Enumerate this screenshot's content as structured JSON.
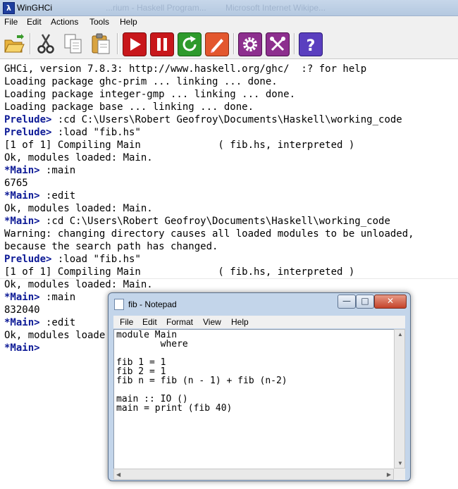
{
  "window": {
    "title": "WinGHCi",
    "bg_tabs": [
      "...rium - Haskell Program...",
      "Microsoft Internet  Wikipe..."
    ]
  },
  "menu": [
    "File",
    "Edit",
    "Actions",
    "Tools",
    "Help"
  ],
  "toolbar": [
    {
      "name": "open-icon",
      "label": "open"
    },
    {
      "name": "cut-icon",
      "label": "cut"
    },
    {
      "name": "copy-icon",
      "label": "copy"
    },
    {
      "name": "paste-icon",
      "label": "paste"
    },
    {
      "name": "run-icon",
      "label": "run"
    },
    {
      "name": "pause-icon",
      "label": "pause"
    },
    {
      "name": "reload-icon",
      "label": "reload"
    },
    {
      "name": "edit-icon",
      "label": "edit"
    },
    {
      "name": "options-icon",
      "label": "options"
    },
    {
      "name": "tools-icon",
      "label": "tools"
    },
    {
      "name": "help-icon",
      "label": "help"
    }
  ],
  "console": [
    {
      "prompt": "",
      "text": "GHCi, version 7.8.3: http://www.haskell.org/ghc/  :? for help"
    },
    {
      "prompt": "",
      "text": "Loading package ghc-prim ... linking ... done."
    },
    {
      "prompt": "",
      "text": "Loading package integer-gmp ... linking ... done."
    },
    {
      "prompt": "",
      "text": "Loading package base ... linking ... done."
    },
    {
      "prompt": "Prelude>",
      "text": " :cd C:\\Users\\Robert Geofroy\\Documents\\Haskell\\working_code"
    },
    {
      "prompt": "Prelude>",
      "text": " :load \"fib.hs\""
    },
    {
      "prompt": "",
      "text": "[1 of 1] Compiling Main             ( fib.hs, interpreted )"
    },
    {
      "prompt": "",
      "text": "Ok, modules loaded: Main."
    },
    {
      "prompt": "*Main>",
      "text": " :main"
    },
    {
      "prompt": "",
      "text": "6765"
    },
    {
      "prompt": "*Main>",
      "text": " :edit"
    },
    {
      "prompt": "",
      "text": "Ok, modules loaded: Main."
    },
    {
      "prompt": "*Main>",
      "text": " :cd C:\\Users\\Robert Geofroy\\Documents\\Haskell\\working_code"
    },
    {
      "prompt": "",
      "text": "Warning: changing directory causes all loaded modules to be unloaded,"
    },
    {
      "prompt": "",
      "text": "because the search path has changed."
    },
    {
      "prompt": "Prelude>",
      "text": " :load \"fib.hs\""
    },
    {
      "prompt": "",
      "text": "[1 of 1] Compiling Main             ( fib.hs, interpreted )"
    },
    {
      "prompt": "",
      "text": "Ok, modules loaded: Main."
    },
    {
      "prompt": "*Main>",
      "text": " :main"
    },
    {
      "prompt": "",
      "text": "832040"
    },
    {
      "prompt": "*Main>",
      "text": " :edit"
    },
    {
      "prompt": "",
      "text": "Ok, modules loade"
    },
    {
      "prompt": "*Main>",
      "text": ""
    }
  ],
  "notepad": {
    "title": "fib - Notepad",
    "menu": [
      "File",
      "Edit",
      "Format",
      "View",
      "Help"
    ],
    "buttons": {
      "minimize": "—",
      "maximize": "□",
      "close": "✕"
    },
    "content": "module Main\n        where\n\nfib 1 = 1\nfib 2 = 1\nfib n = fib (n - 1) + fib (n-2)\n\nmain :: IO ()\nmain = print (fib 40)"
  }
}
